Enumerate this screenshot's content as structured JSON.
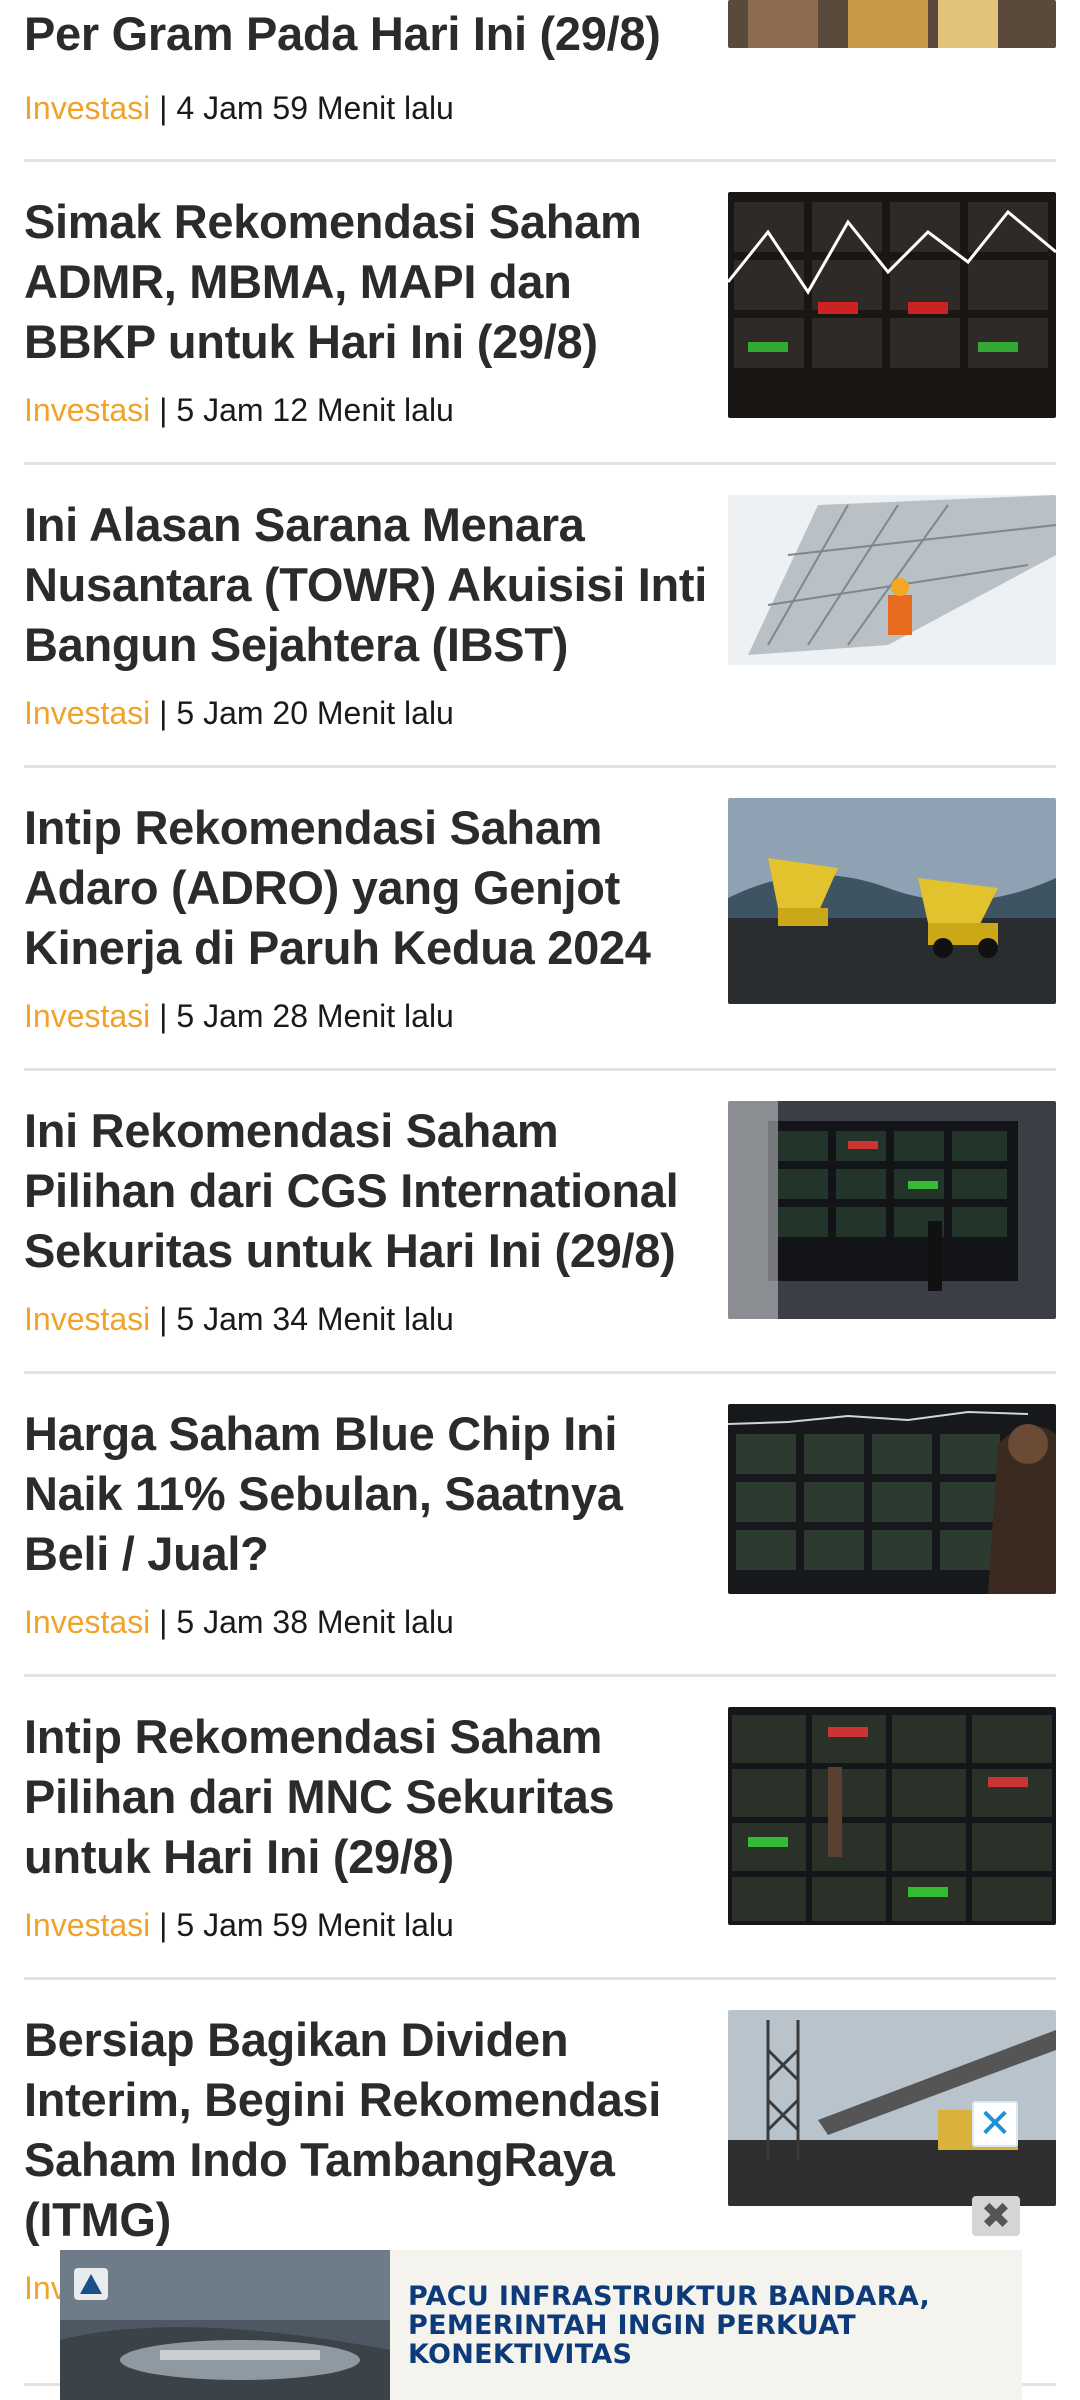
{
  "articles": [
    {
      "title": "Per Gram Pada Hari Ini (29/8)",
      "category": "Investasi",
      "time": "4 Jam 59 Menit lalu",
      "image": "gold-bars-photo"
    },
    {
      "title": "Simak Rekomendasi Saham ADMR, MBMA, MAPI dan BBKP untuk Hari Ini (29/8)",
      "category": "Investasi",
      "time": "5 Jam 12 Menit lalu",
      "image": "stock-board-photo"
    },
    {
      "title": "Ini Alasan Sarana Menara Nusantara (TOWR) Akuisisi Inti Bangun Sejahtera (IBST)",
      "category": "Investasi",
      "time": "5 Jam 20 Menit lalu",
      "image": "satellite-dish-photo"
    },
    {
      "title": "Intip Rekomendasi Saham Adaro (ADRO) yang Genjot Kinerja di Paruh Kedua 2024",
      "category": "Investasi",
      "time": "5 Jam 28 Menit lalu",
      "image": "mining-trucks-photo"
    },
    {
      "title": "Ini Rekomendasi Saham Pilihan dari CGS International Sekuritas untuk Hari Ini (29/8)",
      "category": "Investasi",
      "time": "5 Jam 34 Menit lalu",
      "image": "stock-screen-wall-photo"
    },
    {
      "title": "Harga Saham Blue Chip Ini Naik 11% Sebulan, Saatnya Beli / Jual?",
      "category": "Investasi",
      "time": "5 Jam 38 Menit lalu",
      "image": "stock-board-person-photo"
    },
    {
      "title": "Intip Rekomendasi Saham Pilihan dari MNC Sekuritas untuk Hari Ini (29/8)",
      "category": "Investasi",
      "time": "5 Jam 59 Menit lalu",
      "image": "stock-board-worker-photo"
    },
    {
      "title": "Bersiap Bagikan Dividen Interim, Begini Rekomendasi Saham Indo TambangRaya (ITMG)",
      "category": "Inv",
      "time": "",
      "image": "coal-conveyor-photo"
    }
  ],
  "separator": "|",
  "ad": {
    "headline": "PACU INFRASTRUKTUR BANDARA, PEMERINTAH INGIN PERKUAT KONEKTIVITAS",
    "close_small": "✕",
    "close_big": "✖",
    "colors": {
      "headline": "#0d3b7a",
      "close": "#1e90d6"
    }
  },
  "colors": {
    "category": "#f0a22a",
    "title": "#2b2b2b",
    "divider": "#e4e4e4"
  }
}
